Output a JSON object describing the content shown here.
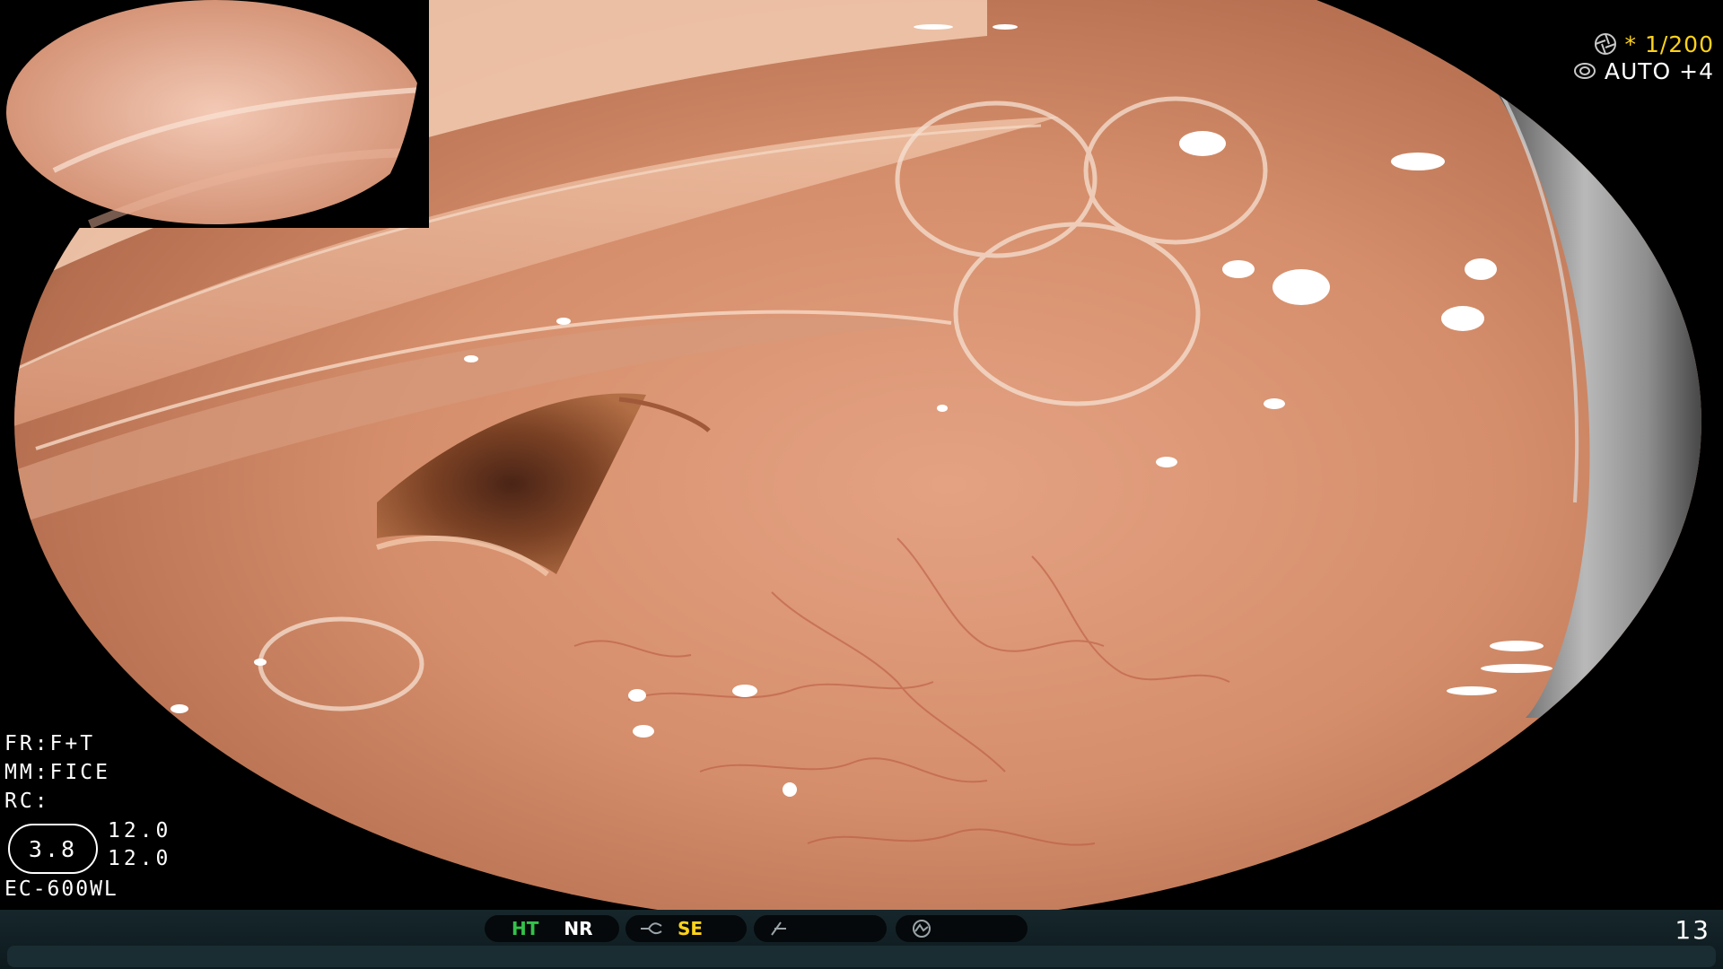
{
  "top_right": {
    "shutter_label": "* 1/200",
    "exposure_label": "AUTO +4"
  },
  "info": {
    "fr": "FR:F+T",
    "mm": "MM:FICE",
    "rc": "RC:",
    "scope_value": "3.8",
    "value_1": "12.0",
    "value_2": "12.0",
    "model": "EC-600WL"
  },
  "status_bar": {
    "ht_label": "HT",
    "nr_label": "NR",
    "se_label": "SE",
    "frame_number": "13"
  },
  "colors": {
    "tissue_base": "#d8906e",
    "status_green": "#34c24a",
    "status_yellow": "#ffd21a"
  }
}
